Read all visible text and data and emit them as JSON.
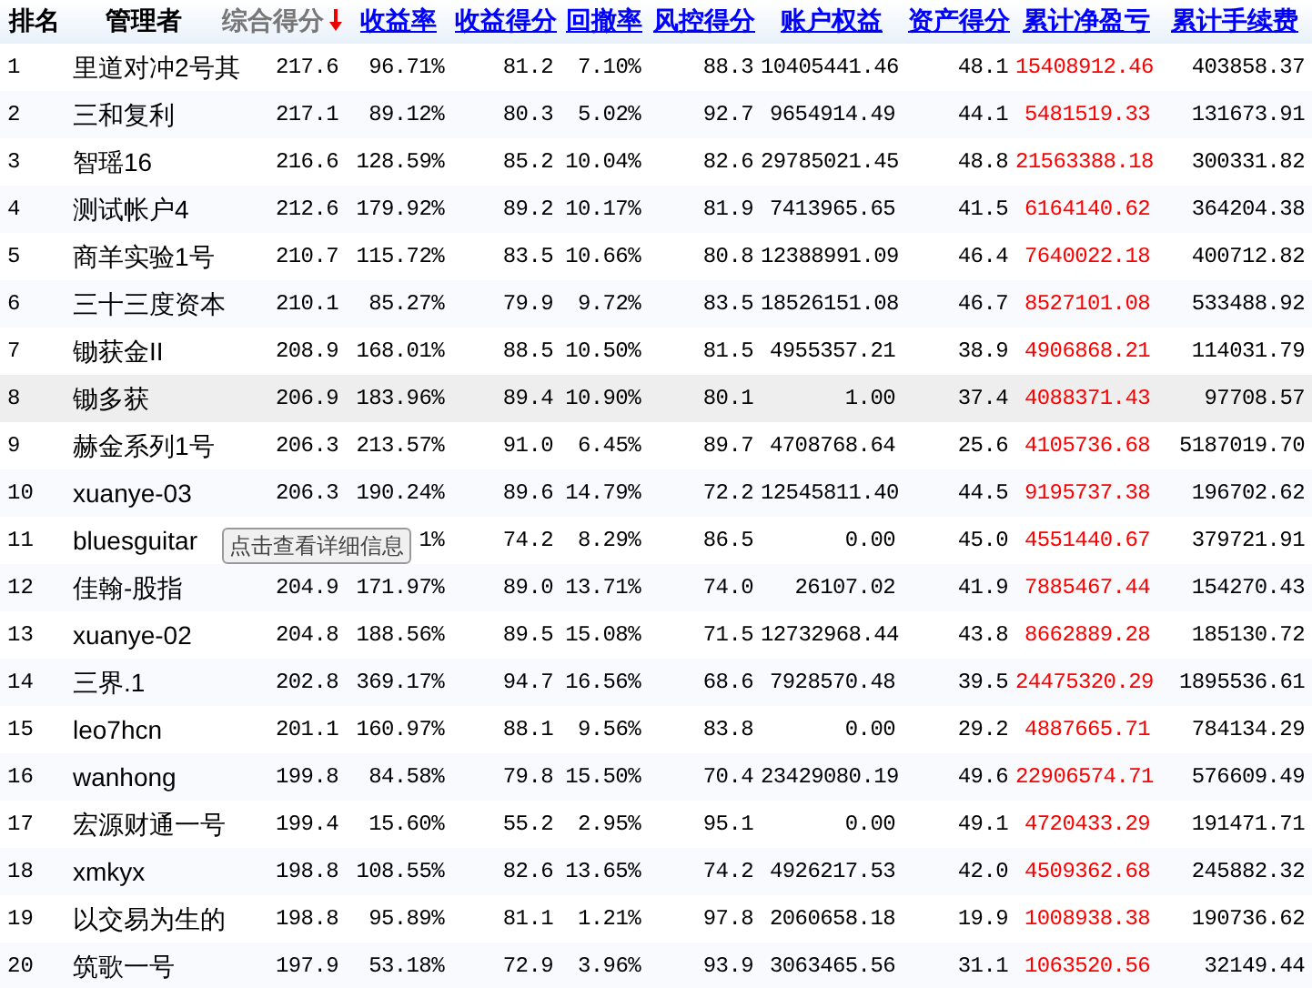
{
  "table": {
    "columns": [
      {
        "label": "排名",
        "kind": "plain",
        "sorted": false
      },
      {
        "label": "管理者",
        "kind": "plain",
        "sorted": false
      },
      {
        "label": "综合得分",
        "kind": "plain",
        "sorted": true
      },
      {
        "label": "收益率",
        "kind": "link",
        "sorted": false
      },
      {
        "label": "收益得分",
        "kind": "link",
        "sorted": false
      },
      {
        "label": "回撤率",
        "kind": "link",
        "sorted": false
      },
      {
        "label": "风控得分",
        "kind": "link",
        "sorted": false
      },
      {
        "label": "账户权益",
        "kind": "link",
        "sorted": false
      },
      {
        "label": "资产得分",
        "kind": "link",
        "sorted": false
      },
      {
        "label": "累计净盈亏",
        "kind": "link",
        "sorted": false
      },
      {
        "label": "累计手续费",
        "kind": "link",
        "sorted": false
      }
    ],
    "rows": [
      {
        "highlighted": false,
        "cells": [
          "1",
          "里道对冲2号其",
          "217.6",
          "96.71%",
          "81.2",
          "7.10%",
          "88.3",
          "10405441.46",
          "48.1",
          "15408912.46",
          "403858.37"
        ]
      },
      {
        "highlighted": false,
        "cells": [
          "2",
          "三和复利",
          "217.1",
          "89.12%",
          "80.3",
          "5.02%",
          "92.7",
          "9654914.49",
          "44.1",
          "5481519.33",
          "131673.91"
        ]
      },
      {
        "highlighted": false,
        "cells": [
          "3",
          "智瑶16",
          "216.6",
          "128.59%",
          "85.2",
          "10.04%",
          "82.6",
          "29785021.45",
          "48.8",
          "21563388.18",
          "300331.82"
        ]
      },
      {
        "highlighted": false,
        "cells": [
          "4",
          "测试帐户4",
          "212.6",
          "179.92%",
          "89.2",
          "10.17%",
          "81.9",
          "7413965.65",
          "41.5",
          "6164140.62",
          "364204.38"
        ]
      },
      {
        "highlighted": false,
        "cells": [
          "5",
          "商羊实验1号",
          "210.7",
          "115.72%",
          "83.5",
          "10.66%",
          "80.8",
          "12388991.09",
          "46.4",
          "7640022.18",
          "400712.82"
        ]
      },
      {
        "highlighted": false,
        "cells": [
          "6",
          "三十三度资本",
          "210.1",
          "85.27%",
          "79.9",
          "9.72%",
          "83.5",
          "18526151.08",
          "46.7",
          "8527101.08",
          "533488.92"
        ]
      },
      {
        "highlighted": false,
        "cells": [
          "7",
          "锄获金II",
          "208.9",
          "168.01%",
          "88.5",
          "10.50%",
          "81.5",
          "4955357.21",
          "38.9",
          "4906868.21",
          "114031.79"
        ]
      },
      {
        "highlighted": true,
        "cells": [
          "8",
          "锄多获",
          "206.9",
          "183.96%",
          "89.4",
          "10.90%",
          "80.1",
          "1.00",
          "37.4",
          "4088371.43",
          "97708.57"
        ]
      },
      {
        "highlighted": false,
        "cells": [
          "9",
          "赫金系列1号",
          "206.3",
          "213.57%",
          "91.0",
          "6.45%",
          "89.7",
          "4708768.64",
          "25.6",
          "4105736.68",
          "5187019.70"
        ]
      },
      {
        "highlighted": false,
        "cells": [
          "10",
          "xuanye-03",
          "206.3",
          "190.24%",
          "89.6",
          "14.79%",
          "72.2",
          "12545811.40",
          "44.5",
          "9195737.38",
          "196702.62"
        ]
      },
      {
        "highlighted": false,
        "cells": [
          "11",
          "bluesguitar",
          "",
          "1%",
          "74.2",
          "8.29%",
          "86.5",
          "0.00",
          "45.0",
          "4551440.67",
          "379721.91"
        ]
      },
      {
        "highlighted": false,
        "cells": [
          "12",
          "佳翰-股指",
          "204.9",
          "171.97%",
          "89.0",
          "13.71%",
          "74.0",
          "26107.02",
          "41.9",
          "7885467.44",
          "154270.43"
        ]
      },
      {
        "highlighted": false,
        "cells": [
          "13",
          "xuanye-02",
          "204.8",
          "188.56%",
          "89.5",
          "15.08%",
          "71.5",
          "12732968.44",
          "43.8",
          "8662889.28",
          "185130.72"
        ]
      },
      {
        "highlighted": false,
        "cells": [
          "14",
          "三界.1",
          "202.8",
          "369.17%",
          "94.7",
          "16.56%",
          "68.6",
          "7928570.48",
          "39.5",
          "24475320.29",
          "1895536.61"
        ]
      },
      {
        "highlighted": false,
        "cells": [
          "15",
          "leo7hcn",
          "201.1",
          "160.97%",
          "88.1",
          "9.56%",
          "83.8",
          "0.00",
          "29.2",
          "4887665.71",
          "784134.29"
        ]
      },
      {
        "highlighted": false,
        "cells": [
          "16",
          "wanhong",
          "199.8",
          "84.58%",
          "79.8",
          "15.50%",
          "70.4",
          "23429080.19",
          "49.6",
          "22906574.71",
          "576609.49"
        ]
      },
      {
        "highlighted": false,
        "cells": [
          "17",
          "宏源财通一号",
          "199.4",
          "15.60%",
          "55.2",
          "2.95%",
          "95.1",
          "0.00",
          "49.1",
          "4720433.29",
          "191471.71"
        ]
      },
      {
        "highlighted": false,
        "cells": [
          "18",
          "xmkyx",
          "198.8",
          "108.55%",
          "82.6",
          "13.65%",
          "74.2",
          "4926217.53",
          "42.0",
          "4509362.68",
          "245882.32"
        ]
      },
      {
        "highlighted": false,
        "cells": [
          "19",
          "以交易为生的",
          "198.8",
          "95.89%",
          "81.1",
          "1.21%",
          "97.8",
          "2060658.18",
          "19.9",
          "1008938.38",
          "190736.62"
        ]
      },
      {
        "highlighted": false,
        "cells": [
          "20",
          "筑歌一号",
          "197.9",
          "53.18%",
          "72.9",
          "3.96%",
          "93.9",
          "3063465.56",
          "31.1",
          "1063520.56",
          "32149.44"
        ]
      }
    ]
  },
  "tooltip": {
    "text": "点击查看详细信息"
  }
}
